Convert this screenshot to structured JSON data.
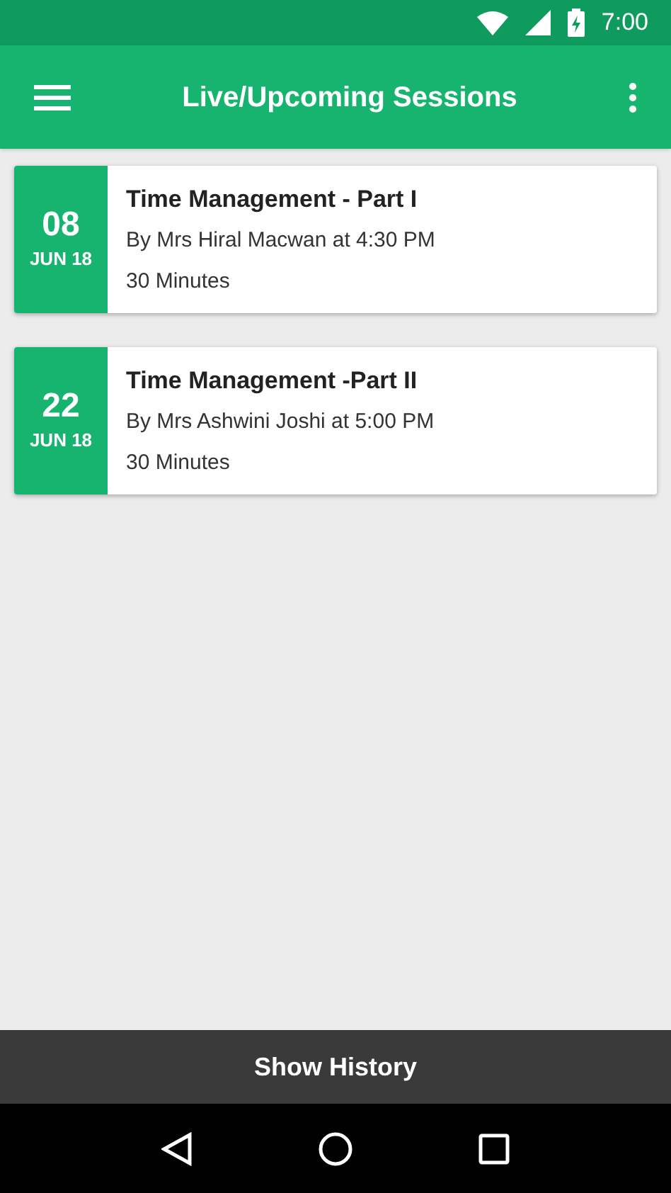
{
  "status_bar": {
    "time": "7:00"
  },
  "app_bar": {
    "title": "Live/Upcoming Sessions"
  },
  "sessions": [
    {
      "day": "08",
      "month": "JUN 18",
      "title": "Time Management - Part I",
      "presenter": "By Mrs Hiral Macwan at 4:30 PM",
      "duration": "30 Minutes"
    },
    {
      "day": "22",
      "month": "JUN 18",
      "title": "Time Management -Part II",
      "presenter": "By Mrs Ashwini Joshi at 5:00 PM",
      "duration": "30 Minutes"
    }
  ],
  "footer_button": {
    "label": "Show History"
  }
}
